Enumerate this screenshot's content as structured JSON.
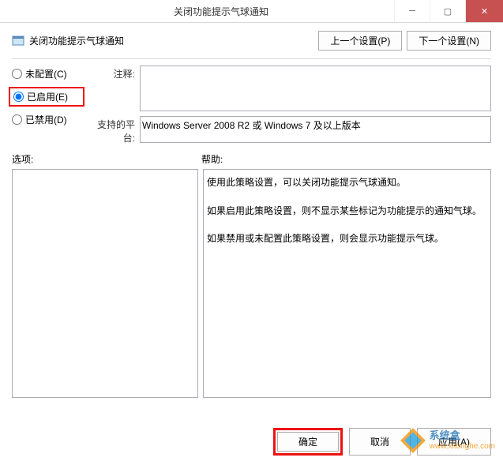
{
  "window": {
    "title": "关闭功能提示气球通知"
  },
  "header": {
    "label": "关闭功能提示气球通知",
    "prev_btn": "上一个设置(P)",
    "next_btn": "下一个设置(N)"
  },
  "radios": {
    "not_configured": "未配置(C)",
    "enabled": "已启用(E)",
    "disabled": "已禁用(D)"
  },
  "fields": {
    "comment_label": "注释:",
    "comment_value": "",
    "supported_label": "支持的平台:",
    "supported_value": "Windows Server 2008 R2 或 Windows 7 及以上版本"
  },
  "panels": {
    "options_label": "选项:",
    "help_label": "帮助:",
    "help_p1": "使用此策略设置，可以关闭功能提示气球通知。",
    "help_p2": "如果启用此策略设置，则不显示某些标记为功能提示的通知气球。",
    "help_p3": "如果禁用或未配置此策略设置，则会显示功能提示气球。"
  },
  "footer": {
    "ok": "确定",
    "cancel": "取消",
    "apply": "应用(A)"
  },
  "watermark": {
    "cn": "系统盒",
    "url": "www.xitonghe.com"
  }
}
